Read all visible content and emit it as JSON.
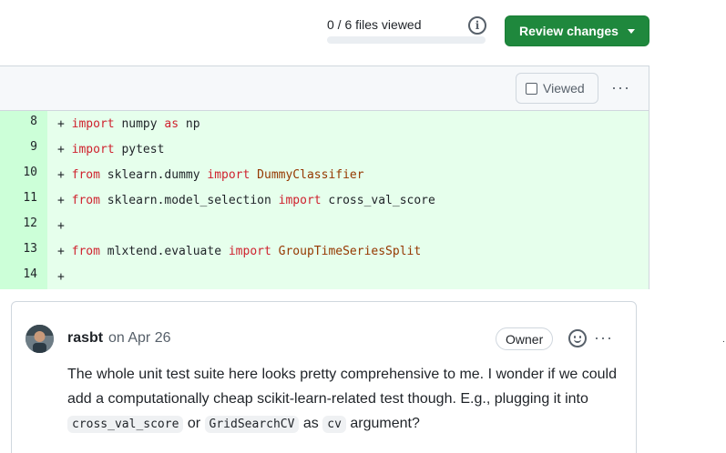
{
  "header": {
    "files_viewed": "0 / 6 files viewed",
    "progress_fraction": 0,
    "review_button": "Review changes"
  },
  "file": {
    "viewed_label": "Viewed",
    "more_label": "···"
  },
  "diff_lines": [
    {
      "num": "8",
      "tokens": [
        {
          "t": "+ ",
          "c": ""
        },
        {
          "t": "import",
          "c": "kw"
        },
        {
          "t": " numpy ",
          "c": ""
        },
        {
          "t": "as",
          "c": "kw"
        },
        {
          "t": " np",
          "c": ""
        }
      ]
    },
    {
      "num": "9",
      "tokens": [
        {
          "t": "+ ",
          "c": ""
        },
        {
          "t": "import",
          "c": "kw"
        },
        {
          "t": " pytest",
          "c": ""
        }
      ]
    },
    {
      "num": "10",
      "tokens": [
        {
          "t": "+ ",
          "c": ""
        },
        {
          "t": "from",
          "c": "kw"
        },
        {
          "t": " sklearn.dummy ",
          "c": ""
        },
        {
          "t": "import",
          "c": "kw"
        },
        {
          "t": " ",
          "c": ""
        },
        {
          "t": "DummyClassifier",
          "c": "cls"
        }
      ]
    },
    {
      "num": "11",
      "tokens": [
        {
          "t": "+ ",
          "c": ""
        },
        {
          "t": "from",
          "c": "kw"
        },
        {
          "t": " sklearn.model_selection ",
          "c": ""
        },
        {
          "t": "import",
          "c": "kw"
        },
        {
          "t": " cross_val_score",
          "c": ""
        }
      ]
    },
    {
      "num": "12",
      "tokens": [
        {
          "t": "+",
          "c": ""
        }
      ]
    },
    {
      "num": "13",
      "tokens": [
        {
          "t": "+ ",
          "c": ""
        },
        {
          "t": "from",
          "c": "kw"
        },
        {
          "t": " mlxtend.evaluate ",
          "c": ""
        },
        {
          "t": "import",
          "c": "kw"
        },
        {
          "t": " ",
          "c": ""
        },
        {
          "t": "GroupTimeSeriesSplit",
          "c": "cls"
        }
      ]
    },
    {
      "num": "14",
      "tokens": [
        {
          "t": "+",
          "c": ""
        }
      ]
    }
  ],
  "comment": {
    "author": "rasbt",
    "date": "on Apr 26",
    "badge": "Owner",
    "body": {
      "text1": "The whole unit test suite here looks pretty comprehensive to me. I wonder if we could add a computationally cheap scikit-learn-related test though. E.g., plugging it into ",
      "code1": "cross_val_score",
      "text2": " or ",
      "code2": "GridSearchCV",
      "text3": " as ",
      "code3": "cv",
      "text4": " argument?"
    },
    "more_label": "···"
  },
  "colors": {
    "accent_green": "#1f883d",
    "diff_bg": "#e6ffec",
    "gutter_bg": "#ccffd8",
    "keyword": "#cf222e",
    "class_name": "#953800"
  },
  "icons": [
    "info-icon",
    "caret-down-icon",
    "kebab-icon",
    "smiley-icon",
    "avatar"
  ]
}
